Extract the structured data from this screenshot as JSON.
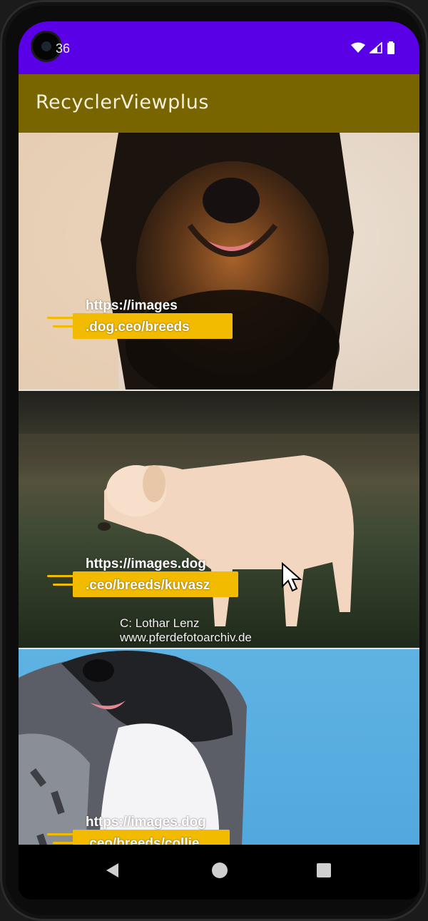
{
  "status_bar": {
    "time": "36",
    "icons": [
      "wifi-icon",
      "cellular-signal-icon",
      "battery-icon"
    ]
  },
  "app_bar": {
    "title": "RecyclerViewplus",
    "color": "#786500"
  },
  "status_bar_color": "#5a00e6",
  "list": {
    "items": [
      {
        "url_line1": "https://images",
        "url_line2": ".dog.ceo/breeds",
        "image": "dog-photo-black-tan"
      },
      {
        "url_line1": "https://images.dog",
        "url_line2": ".ceo/breeds/kuvasz",
        "image": "dog-photo-kuvasz",
        "watermark_line1": "C:  Lothar Lenz",
        "watermark_line2": "www.pferdefotoarchiv.de"
      },
      {
        "url_line1": "https://images.dog",
        "url_line2": ".ceo/breeds/collie",
        "image": "dog-photo-collie"
      }
    ],
    "accent_color": "#f2bb00"
  },
  "nav_bar": {
    "back": "back-triangle-icon",
    "home": "home-circle-icon",
    "recents": "recents-square-icon"
  }
}
